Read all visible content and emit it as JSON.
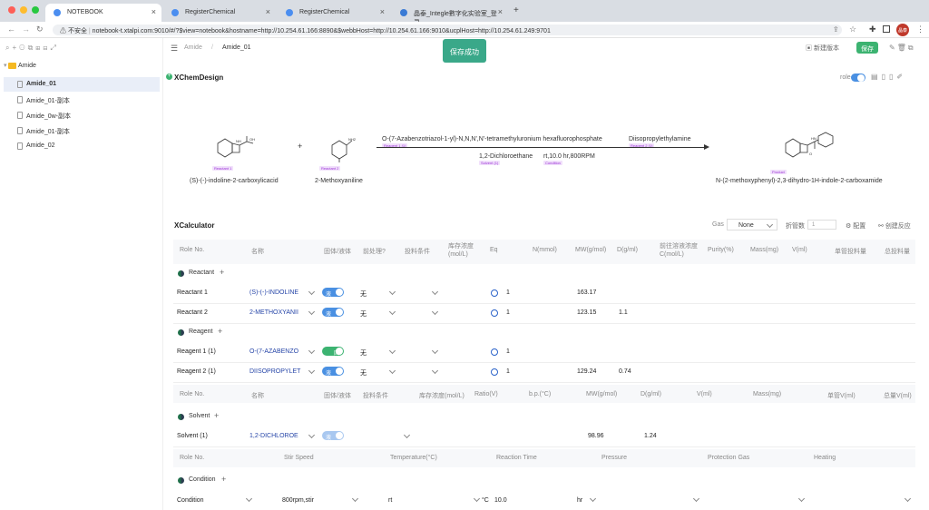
{
  "browser": {
    "tabs": [
      {
        "label": "NOTEBOOK",
        "active": true
      },
      {
        "label": "RegisterChemical",
        "active": false
      },
      {
        "label": "RegisterChemical",
        "active": false
      },
      {
        "label": "晶泰_Integle數字化实验室_登录",
        "active": false
      }
    ],
    "new_tab": "+",
    "insecure_label": "不安全",
    "url": "notebook-t.xtalpi.com:9010/#/?$view=notebook&hostname=http://10.254.61.166:8890&$webbHost=http://10.254.61.166:9010&ucplHost=http://10.254.61.249:9701",
    "avatar": "晶泰"
  },
  "sidebar": {
    "folder": "Amide",
    "items": [
      {
        "label": "Amide_01",
        "selected": true
      },
      {
        "label": "Amide_01-副本",
        "selected": false
      },
      {
        "label": "Amide_0w-副本",
        "selected": false
      },
      {
        "label": "Amide_01-副本",
        "selected": false
      },
      {
        "label": "Amide_02",
        "selected": false
      }
    ]
  },
  "header": {
    "breadcrumb_root": "Amide",
    "separator": "/",
    "breadcrumb_page": "Amide_01",
    "new_version": "新建版本",
    "save": "保存",
    "toast": "保存成功"
  },
  "xchem": {
    "title": "XChemDesign",
    "role_label": "role",
    "reactant1_tag": "Reactant 1",
    "reactant1_name": "(S)-(-)-indoline-2-carboxylicacid",
    "plus": "+",
    "reactant2_tag": "Reactant 2",
    "reactant2_name": "2-Methoxyaniline",
    "reagent_top": "O-(7-Azabenzotriazol-1-yl)-N,N,N',N'-tetramethyluronium hexafluorophosphate",
    "reagent_top2": "Diisopropylethylamine",
    "reagent1_tag": "Reagent 1 (1)",
    "reagent2_tag": "Reagent 2 (1)",
    "solvent_text": "1,2-Dichloroethane",
    "condition_text": "rt,10.0 hr,800RPM",
    "solvent_tag": "Solvent (1)",
    "condition_tag": "Condition",
    "product_tag": "Product",
    "product_name": "N-(2-methoxyphenyl)-2,3-dihydro-1H-indole-2-carboxamide"
  },
  "calc": {
    "title": "XCalculator",
    "gas_label": "Gas",
    "gas_value": "None",
    "fold_label": "折管数",
    "fold_value": "1",
    "config": "配置",
    "create_reaction": "创建反应",
    "columns": [
      "Role No.",
      "名称",
      "固体/液体",
      "前处理?",
      "投料条件",
      "库存浓度(mol/L)",
      "Eq",
      "N(mmol)",
      "MW(g/mol)",
      "D(g/ml)",
      "前往溶液浓度C(mol/L)",
      "Purity(%)",
      "Mass(mg)",
      "V(ml)",
      "单管投料量",
      "总投料量"
    ],
    "reactant_section": "Reactant",
    "reagent_section": "Reagent",
    "solvent_section": "Solvent",
    "condition_section": "Condition",
    "rows": [
      {
        "role": "Reactant 1",
        "name": "(S)-(-)-INDOLINE",
        "state": "液",
        "pre": "无",
        "eq": "1",
        "mw": "163.17",
        "d": ""
      },
      {
        "role": "Reactant 2",
        "name": "2-METHOXYANII",
        "state": "液",
        "pre": "无",
        "eq": "1",
        "mw": "123.15",
        "d": "1.1"
      },
      {
        "role": "Reagent 1 (1)",
        "name": "O-(7-AZABENZO",
        "state": "固",
        "pre": "无",
        "eq": "1",
        "mw": "",
        "d": ""
      },
      {
        "role": "Reagent 2 (1)",
        "name": "DIISOPROPYLET",
        "state": "液",
        "pre": "无",
        "eq": "1",
        "mw": "129.24",
        "d": "0.74"
      }
    ],
    "solvent_columns": [
      "Role No.",
      "名称",
      "固体/液体",
      "投料条件",
      "库存浓度(mol/L)",
      "Ratio(V)",
      "b.p.(°C)",
      "MW(g/mol)",
      "D(g/ml)",
      "V(ml)",
      "Mass(mg)",
      "单管V(ml)",
      "总量V(ml)"
    ],
    "solvent_row": {
      "role": "Solvent (1)",
      "name": "1,2-DICHLOROE",
      "state": "液",
      "mw": "98.96",
      "d": "1.24"
    },
    "condition_columns": [
      "Role No.",
      "Stir Speed",
      "Temperature(°C)",
      "Reaction Time",
      "Pressure",
      "Protection Gas",
      "Heating"
    ],
    "condition_row": {
      "role": "Condition",
      "stir": "800rpm,stir",
      "temp": "rt",
      "temp_unit": "°C",
      "time": "10.0",
      "time_unit": "hr"
    }
  }
}
